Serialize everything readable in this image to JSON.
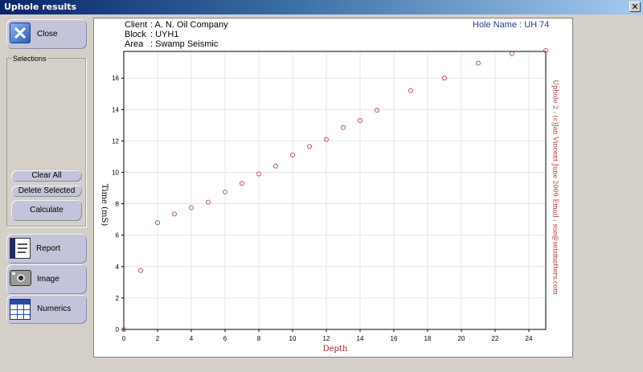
{
  "window": {
    "title": "Uphole results",
    "close_glyph": "✕"
  },
  "sidebar": {
    "close_label": "Close",
    "selections_label": "Selections",
    "clear_all_label": "Clear All",
    "delete_selected_label": "Delete Selected",
    "calculate_label": "Calculate",
    "report_label": "Report",
    "image_label": "Image",
    "numerics_label": "Numerics"
  },
  "header": {
    "client_key": "Client",
    "client_value": ": A. N. Oil Company",
    "block_key": "Block",
    "block_value": ": UYH1",
    "area_key": "Area",
    "area_value": ": Swamp Seismic",
    "hole_name": "Hole Name : UH 74"
  },
  "side_text": "Uphole 2 : (c)Jan Vincent June 2009 Email : sue@seismatters.com",
  "chart_data": {
    "type": "scatter",
    "xlabel": "Depth",
    "ylabel": "Time (mS)",
    "xlim": [
      0,
      25
    ],
    "ylim": [
      0,
      17.7
    ],
    "xticks": [
      0,
      2,
      4,
      6,
      8,
      10,
      12,
      14,
      16,
      18,
      20,
      22,
      24
    ],
    "yticks": [
      0,
      2,
      4,
      6,
      8,
      10,
      12,
      14,
      16
    ],
    "grid": true,
    "marker_color": "#c0504d",
    "points": [
      [
        0,
        0
      ],
      [
        1,
        3.75
      ],
      [
        2,
        6.8
      ],
      [
        3,
        7.35
      ],
      [
        4,
        7.75
      ],
      [
        5,
        8.1
      ],
      [
        6,
        8.75
      ],
      [
        7,
        9.3
      ],
      [
        8,
        9.9
      ],
      [
        9,
        10.4
      ],
      [
        10,
        11.1
      ],
      [
        11,
        11.65
      ],
      [
        12,
        12.1
      ],
      [
        13,
        12.85
      ],
      [
        14,
        13.3
      ],
      [
        15,
        13.95
      ],
      [
        17,
        15.2
      ],
      [
        19,
        16.0
      ],
      [
        21,
        16.95
      ],
      [
        23,
        17.55
      ],
      [
        25,
        17.75
      ]
    ]
  }
}
